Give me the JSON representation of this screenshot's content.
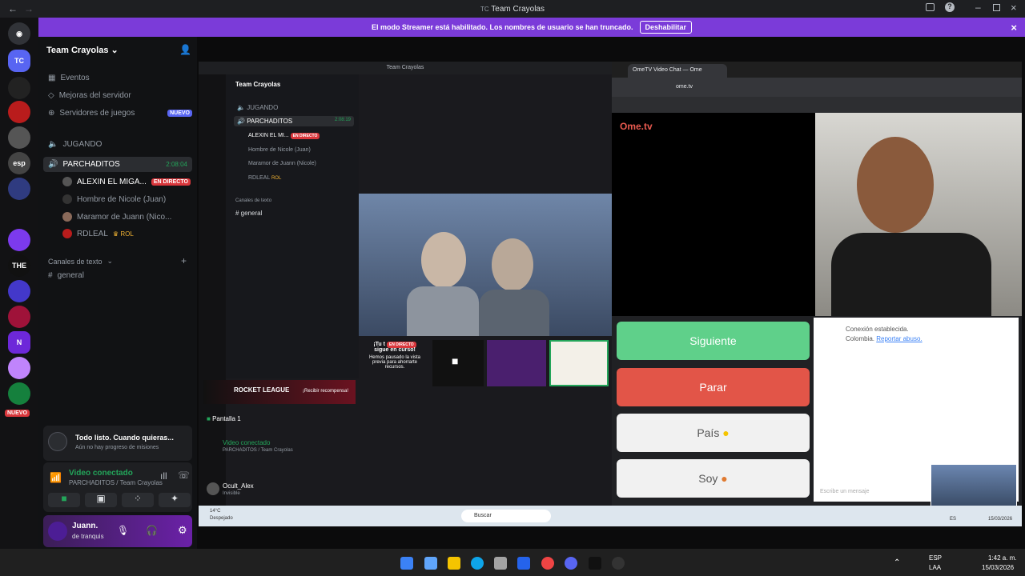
{
  "window": {
    "title": "Team Crayolas"
  },
  "banner": {
    "text": "El modo Streamer está habilitado. Los nombres de usuario se han truncado.",
    "button": "Deshabilitar"
  },
  "guilds": {
    "new_badge": "NUEVO"
  },
  "server": {
    "name": "Team Crayolas",
    "menu": [
      "Eventos",
      "Mejoras del servidor",
      "Servidores de juegos"
    ],
    "games_badge": "NUEVO",
    "voice_channels": [
      {
        "name": "JUGANDO"
      },
      {
        "name": "PARCHADITOS",
        "time": "2:08:04"
      }
    ],
    "members": [
      {
        "name": "ALEXIN EL MIGA...",
        "badge": "EN DIRECTO"
      },
      {
        "name": "Hombre de Nicole (Juan)"
      },
      {
        "name": "Maramor de Juann (Nico..."
      },
      {
        "name": "RDLEAL",
        "badge": "ROL"
      }
    ],
    "text_header": "Canales de texto",
    "text_channel": "general"
  },
  "quest": {
    "title": "Todo listo. Cuando quieras...",
    "subtitle": "Aún no hay progreso de misiones"
  },
  "voice": {
    "status": "Video conectado",
    "location": "PARCHADITOS / Team Crayolas"
  },
  "user": {
    "name": "Juann.",
    "status": "de tranquis"
  },
  "inner": {
    "title": "Team Crayolas",
    "server": "Team Crayolas",
    "voice_channels": [
      "JUGANDO",
      "PARCHADITOS"
    ],
    "time": "2:08:19",
    "members": [
      "ALEXIN EL MI...",
      "Hombre de Nicole (Juan)",
      "Maramor de Juann (Nicole)",
      "RDLEAL"
    ],
    "live": "EN DIRECTO",
    "rol": "ROL",
    "text_header": "Canales de texto",
    "text_channel": "general",
    "paused": {
      "line1": "¡Tu t",
      "line2": "sigue en curso!",
      "line3": "Hemos pausado la vista previa para ahorrarte recursos."
    },
    "promo": {
      "game": "ROCKET LEAGUE",
      "button": "¡Recibir recompensa!"
    },
    "screen": "Pantalla 1",
    "voice_status": "Video conectado",
    "voice_location": "PARCHADITOS / Team Crayolas",
    "user": "Ocult_Alex",
    "user_status": "Invisible"
  },
  "browser": {
    "tab": "OmeTV Video Chat — Ome",
    "url": "ome.tv",
    "logo": "Ome.tv",
    "buttons": {
      "next": "Siguiente",
      "stop": "Parar",
      "country": "País",
      "gender": "Soy"
    },
    "chat_status": "Conexión establecida.",
    "country": "Colombia.",
    "report": "Reportar abuso.",
    "input_placeholder": "Escribe un mensaje"
  },
  "inner_taskbar": {
    "weather": "14°C",
    "weather_desc": "Despejado",
    "search": "Buscar",
    "lang": "ES",
    "date": "15/03/2026"
  },
  "taskbar": {
    "lang1": "ESP",
    "lang2": "LAA",
    "time": "1:42 a. m.",
    "date": "15/03/2026"
  }
}
